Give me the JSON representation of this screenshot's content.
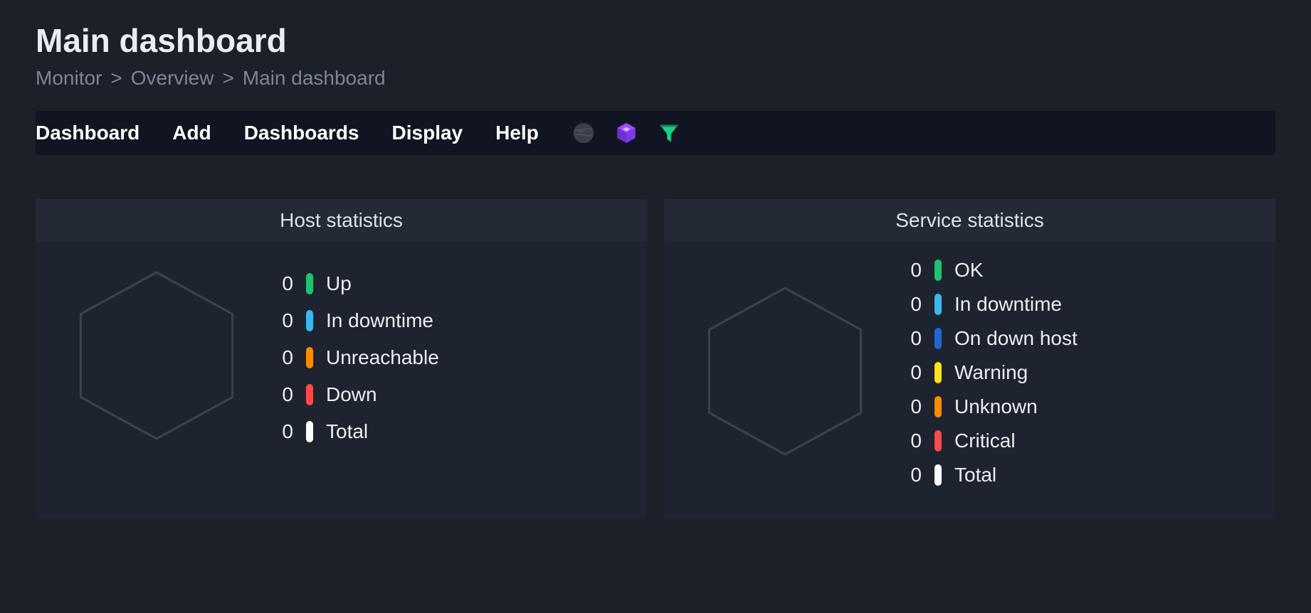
{
  "page": {
    "title": "Main dashboard"
  },
  "breadcrumb": {
    "items": [
      "Monitor",
      "Overview",
      "Main dashboard"
    ],
    "separator": ">"
  },
  "toolbar": {
    "menu": [
      {
        "label": "Dashboard"
      },
      {
        "label": "Add"
      },
      {
        "label": "Dashboards"
      },
      {
        "label": "Display"
      },
      {
        "label": "Help"
      }
    ]
  },
  "panels": {
    "host": {
      "title": "Host statistics",
      "items": [
        {
          "count": 0,
          "label": "Up",
          "color": "#1ec36e"
        },
        {
          "count": 0,
          "label": "In downtime",
          "color": "#3ab8f0"
        },
        {
          "count": 0,
          "label": "Unreachable",
          "color": "#ff8a00"
        },
        {
          "count": 0,
          "label": "Down",
          "color": "#ff4a4a"
        },
        {
          "count": 0,
          "label": "Total",
          "color": "#ffffff"
        }
      ]
    },
    "service": {
      "title": "Service statistics",
      "items": [
        {
          "count": 0,
          "label": "OK",
          "color": "#1ec36e"
        },
        {
          "count": 0,
          "label": "In downtime",
          "color": "#3ab8f0"
        },
        {
          "count": 0,
          "label": "On down host",
          "color": "#1f68d4"
        },
        {
          "count": 0,
          "label": "Warning",
          "color": "#ffe21a"
        },
        {
          "count": 0,
          "label": "Unknown",
          "color": "#ff8a00"
        },
        {
          "count": 0,
          "label": "Critical",
          "color": "#ff4a4a"
        },
        {
          "count": 0,
          "label": "Total",
          "color": "#ffffff"
        }
      ]
    }
  },
  "colors": {
    "hexagon_stroke": "#3a4250"
  }
}
